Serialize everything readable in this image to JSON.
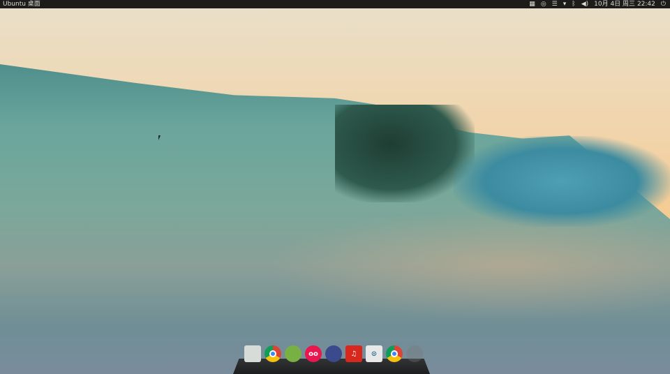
{
  "topbar": {
    "title": "Ubuntu 桌面",
    "date": "10月 4日",
    "weekday": "周三",
    "time": "22:42",
    "indicators": [
      "keyboard-icon",
      "steam-icon",
      "input-method-icon",
      "wifi-icon",
      "bluetooth-icon",
      "volume-icon",
      "power-icon"
    ]
  },
  "dock": {
    "items": [
      {
        "name": "files",
        "color": "#d8dcd8"
      },
      {
        "name": "chrome",
        "color": "#db4437"
      },
      {
        "name": "android-studio",
        "color": "#78b043"
      },
      {
        "name": "flickr-app",
        "color": "#e8174e",
        "glyph": "oo"
      },
      {
        "name": "shutter",
        "color": "#3a4a8c"
      },
      {
        "name": "netease-music",
        "color": "#d8281e",
        "glyph": "♫"
      },
      {
        "name": "settings-toggles",
        "color": "#e8e8e8"
      },
      {
        "name": "chrome-2",
        "color": "#db4437"
      },
      {
        "name": "trash",
        "color": "#777777"
      }
    ]
  }
}
